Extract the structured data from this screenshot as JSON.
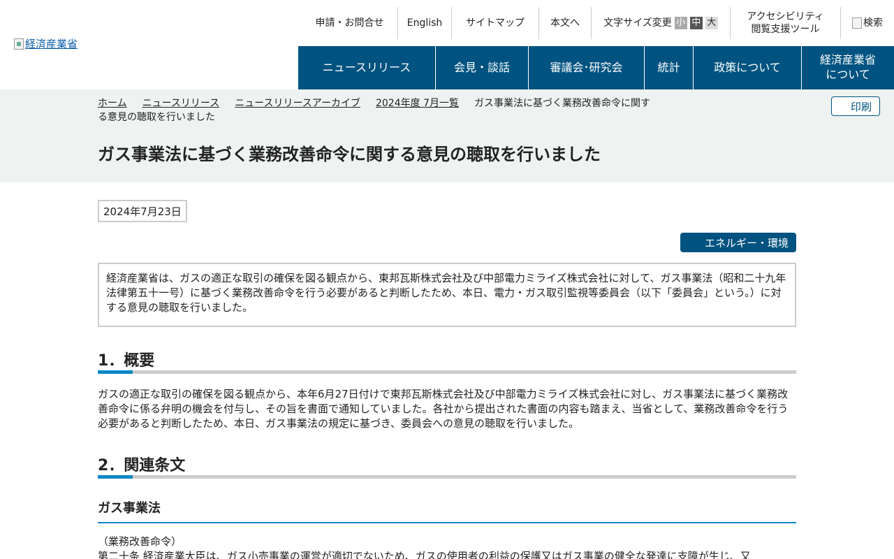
{
  "logo": {
    "alt": "経済産業省"
  },
  "util": {
    "contact": "申請・お問合せ",
    "english": "English",
    "sitemap": "サイトマップ",
    "skip": "本文へ",
    "fontsize_label": "文字サイズ変更",
    "fs_small": "小",
    "fs_medium": "中",
    "fs_large": "大",
    "accessibility_1": "アクセシビリティ",
    "accessibility_2": "閲覧支援ツール",
    "search": "検索"
  },
  "gnav": {
    "news": "ニュースリリース",
    "kaiken": "会見・談話",
    "shingikai": "審議会･研究会",
    "toukei": "統計",
    "seisaku": "政策について",
    "about_1": "経済産業省",
    "about_2": "について"
  },
  "breadcrumb": {
    "home": "ホーム",
    "news": "ニュースリリース",
    "archive": "ニュースリリースアーカイブ",
    "month": "2024年度 7月一覧",
    "current": "ガス事業法に基づく業務改善命令に関する意見の聴取を行いました"
  },
  "print_label": "印刷",
  "page_title": "ガス事業法に基づく業務改善命令に関する意見の聴取を行いました",
  "date": "2024年7月23日",
  "category_tag": "エネルギー・環境",
  "lead": "経済産業省は、ガスの適正な取引の確保を図る観点から、東邦瓦斯株式会社及び中部電力ミライズ株式会社に対して、ガス事業法（昭和二十九年法律第五十一号）に基づく業務改善命令を行う必要があると判断したため、本日、電力・ガス取引監視等委員会（以下「委員会」という。）に対する意見の聴取を行いました。",
  "section1": {
    "heading": "1．概要",
    "body": "ガスの適正な取引の確保を図る観点から、本年6月27日付けで東邦瓦斯株式会社及び中部電力ミライズ株式会社に対し、ガス事業法に基づく業務改善命令に係る弁明の機会を付与し、その旨を書面で通知していました。各社から提出された書面の内容も踏まえ、当省として、業務改善命令を行う必要があると判断したため、本日、ガス事業法の規定に基づき、委員会への意見の聴取を行いました。"
  },
  "section2": {
    "heading": "2．関連条文",
    "law_title": "ガス事業法",
    "article_caption": "（業務改善命令）",
    "article_text": "第二十条 経済産業大臣は、ガス小売事業の運営が適切でないため、ガスの使用者の利益の保護又はガス事業の健全な発達に支障が生じ、又"
  }
}
